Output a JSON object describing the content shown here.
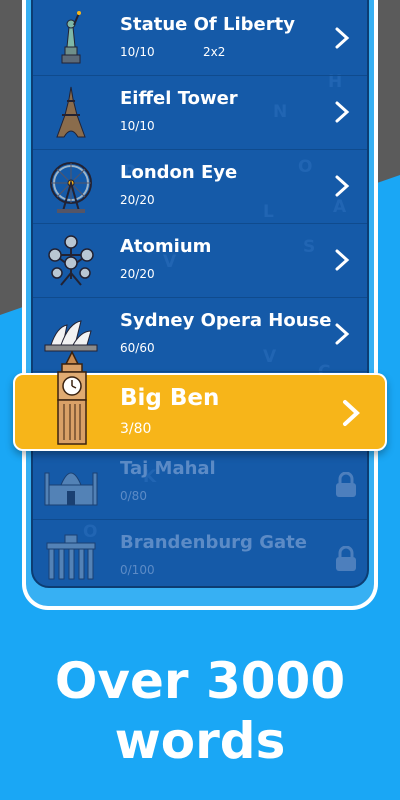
{
  "levels": [
    {
      "title": "Statue Of Liberty",
      "progress": "10/10",
      "extra": "2x2",
      "icon": "statue-of-liberty-icon"
    },
    {
      "title": "Eiffel Tower",
      "progress": "10/10",
      "icon": "eiffel-tower-icon"
    },
    {
      "title": "London Eye",
      "progress": "20/20",
      "icon": "london-eye-icon"
    },
    {
      "title": "Atomium",
      "progress": "20/20",
      "icon": "atomium-icon"
    },
    {
      "title": "Sydney Opera House",
      "progress": "60/60",
      "icon": "sydney-opera-house-icon"
    },
    {
      "title": "Big Ben",
      "progress": "3/80",
      "icon": "big-ben-icon"
    },
    {
      "title": "Taj Mahal",
      "progress": "0/80",
      "icon": "taj-mahal-icon"
    },
    {
      "title": "Brandenburg Gate",
      "progress": "0/100",
      "icon": "brandenburg-gate-icon"
    }
  ],
  "headline": {
    "line1": "Over 3000",
    "line2": "words"
  },
  "colors": {
    "background": "#1aa7f5",
    "list": "#155aa8",
    "highlight": "#f7b519",
    "text": "#ffffff"
  }
}
